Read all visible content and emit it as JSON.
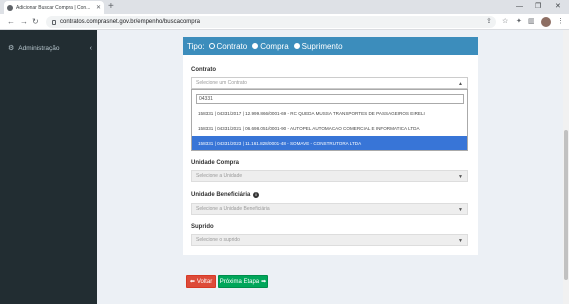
{
  "browser": {
    "tab_title": "Adicionar Buscar Compra | Con...",
    "new_tab": "+",
    "url": "contratos.comprasnet.gov.br/empenho/buscacompra"
  },
  "sidebar": {
    "items": [
      {
        "label": "Administração",
        "icon": "gear-icon"
      }
    ]
  },
  "form": {
    "tipo_label": "Tipo:",
    "tipo_options": [
      "Contrato",
      "Compra",
      "Suprimento"
    ],
    "contrato": {
      "label": "Contrato",
      "placeholder": "Selecione um Contrato",
      "search_value": "04331",
      "options": [
        "158331 | 04331/2017 | 12.999.866/0001-69 - RC QUEDA MUSSA TRANSPORTES DE PASSAGEIROS EIRELI",
        "158331 | 04331/2021 | 06.698.051/0001-90 - AUTOPEL AUTOMACAO COMERCIAL E INFORMATICA LTDA",
        "158331 | 04331/2023 | 11.161.828/0001-48 - SOMAVE - CONSTRUTORA LTDA"
      ]
    },
    "unidade_compra": {
      "label": "Unidade Compra",
      "placeholder": "Selecione a Unidade"
    },
    "unidade_beneficiaria": {
      "label": "Unidade Beneficiária",
      "placeholder": "Selecione a Unidade Beneficiária"
    },
    "suprido": {
      "label": "Suprido",
      "placeholder": "Selecione o suprido"
    }
  },
  "buttons": {
    "back": "Voltar",
    "next": "Próxima Etapa"
  }
}
